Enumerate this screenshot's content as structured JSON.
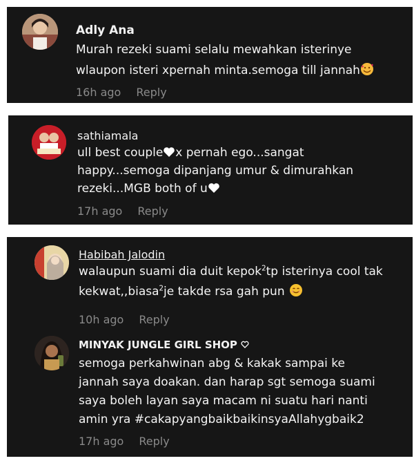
{
  "comments": [
    {
      "username": "Adly Ana",
      "lines": [
        "Murah rezeki suami selalu mewahkan isterinye",
        "wlaupon isteri xpernah minta.semoga till jannah"
      ],
      "emoji": "smiling-face-with-hearts",
      "time": "16h ago",
      "reply": "Reply"
    },
    {
      "username": "sathiamala",
      "line1a": "ull best couple",
      "line1b": "x pernah ego...sangat",
      "line2": "happy...semoga dipanjang umur & dimurahkan",
      "line3a": "rezeki...MGB both of u",
      "heart": "white-heart",
      "time": "17h ago",
      "reply": "Reply"
    },
    {
      "username": "Habibah Jalodin",
      "line1a": "walaupun suami dia duit kepok",
      "sup1": "2",
      "line1b": "tp isterinya cool tak",
      "line2a": "kekwat,,biasa",
      "sup2": "2",
      "line2b": "je takde rsa gah pun",
      "emoji": "smiling-face",
      "time": "10h ago",
      "reply": "Reply"
    },
    {
      "username": "MINYAK JUNGLE GIRL SHOP",
      "badge": "heart-outline",
      "lines": [
        "semoga perkahwinan abg & kakak sampai ke",
        "jannah saya doakan. dan harap sgt semoga suami",
        "saya boleh layan saya macam ni suatu hari nanti",
        "amin yra #cakapyangbaikbaikinsyaAllahygbaik2"
      ],
      "time": "17h ago",
      "reply": "Reply"
    }
  ]
}
